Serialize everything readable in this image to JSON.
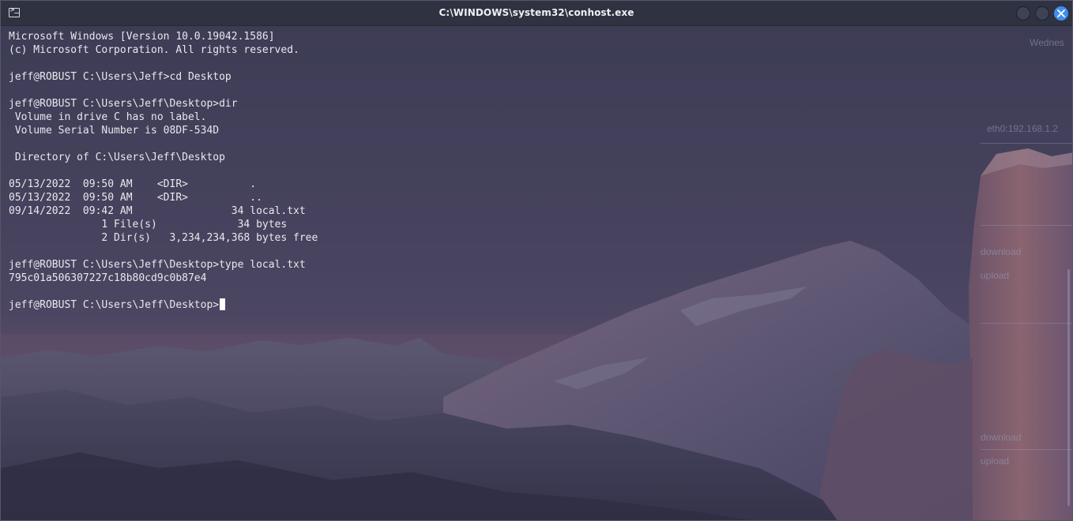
{
  "window": {
    "title": "C:\\WINDOWS\\system32\\conhost.exe",
    "icon": "console-icon",
    "controls": [
      "minimize-icon",
      "maximize-icon",
      "close-icon"
    ],
    "accent_color": "#3d8ff0"
  },
  "terminal": {
    "lines": [
      "Microsoft Windows [Version 10.0.19042.1586]",
      "(c) Microsoft Corporation. All rights reserved.",
      "",
      "jeff@ROBUST C:\\Users\\Jeff>cd Desktop",
      "",
      "jeff@ROBUST C:\\Users\\Jeff\\Desktop>dir",
      " Volume in drive C has no label.",
      " Volume Serial Number is 08DF-534D",
      "",
      " Directory of C:\\Users\\Jeff\\Desktop",
      "",
      "05/13/2022  09:50 AM    <DIR>          .",
      "05/13/2022  09:50 AM    <DIR>          ..",
      "09/14/2022  09:42 AM                34 local.txt",
      "               1 File(s)             34 bytes",
      "               2 Dir(s)   3,234,234,368 bytes free",
      "",
      "jeff@ROBUST C:\\Users\\Jeff\\Desktop>type local.txt",
      "795c01a506307227c18b80cd9c0b87e4",
      ""
    ],
    "prompt": "jeff@ROBUST C:\\Users\\Jeff\\Desktop>"
  },
  "desktop_widget": {
    "day": "Wednes",
    "interface": "eth0:192.168.1.2",
    "download_1": "download",
    "upload_1": "upload",
    "download_2": "download",
    "upload_2": "upload"
  }
}
